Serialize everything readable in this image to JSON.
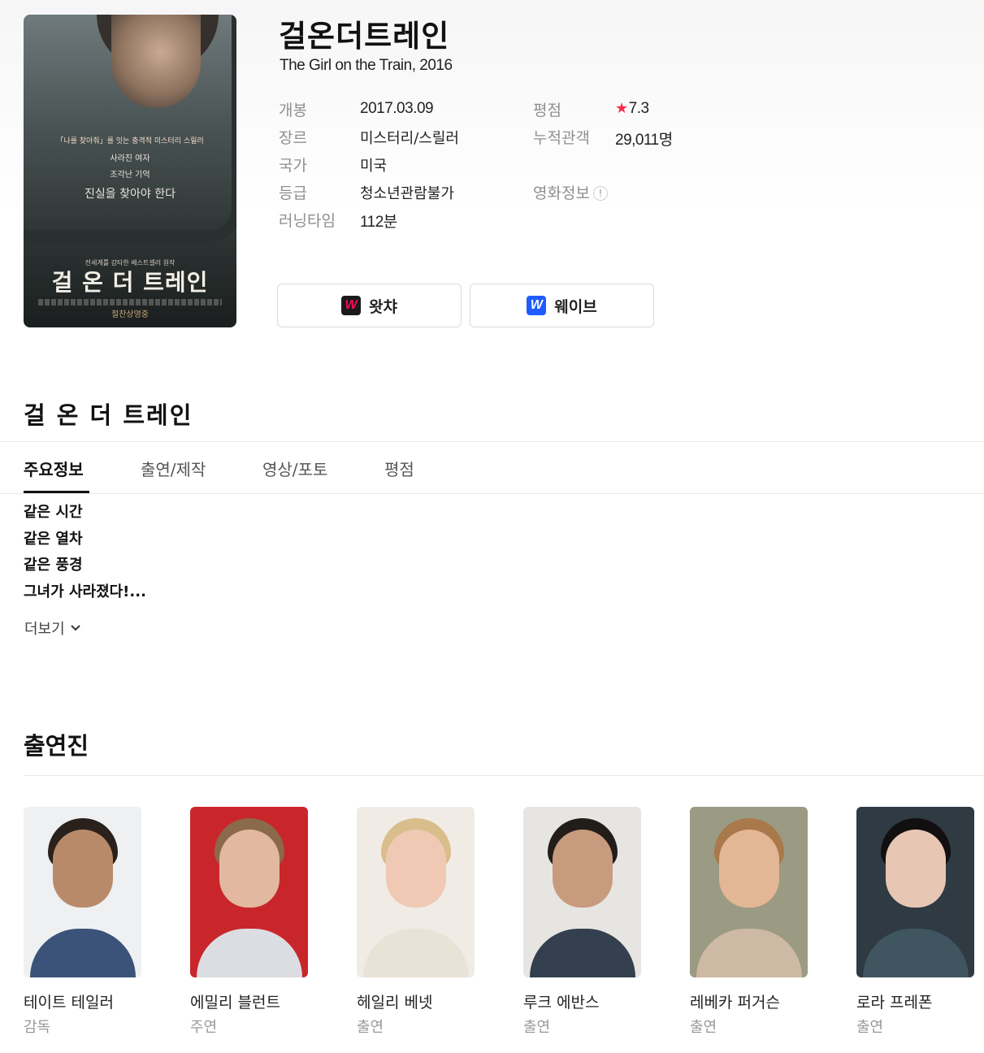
{
  "poster": {
    "tagline_1": "「나를 찾아줘」를 잇는 충격적 미스터리 스릴러",
    "tagline_2": "사라진 여자",
    "tagline_3": "조각난 기억",
    "tagline_4": "진실을 찾아야 한다",
    "top_text": "전세계를 강타한 베스트셀러 원작",
    "poster_title": "걸 온 더 트레인",
    "bottom_text": "절찬상영중"
  },
  "movie": {
    "title": "걸온더트레인",
    "subtitle": "The Girl on the Train, 2016"
  },
  "info": {
    "release_label": "개봉",
    "release_value": "2017.03.09",
    "genre_label": "장르",
    "genre_value": "미스터리/스릴러",
    "country_label": "국가",
    "country_value": "미국",
    "rating_label": "등급",
    "rating_value": "청소년관람불가",
    "runtime_label": "러닝타임",
    "runtime_value": "112분",
    "score_label": "평점",
    "score_value": "7.3",
    "audience_label": "누적관객",
    "audience_value": "29,011명",
    "movie_info_label": "영화정보"
  },
  "ott": [
    {
      "label": "왓챠",
      "logo": "W",
      "icon": "watcha-logo-icon",
      "color": "#ff0558"
    },
    {
      "label": "웨이브",
      "logo": "W",
      "icon": "wavve-logo-icon",
      "color": "#1f5bff"
    }
  ],
  "section_title": "걸 온 더 트레인",
  "tabs": [
    {
      "label": "주요정보",
      "active": true
    },
    {
      "label": "출연/제작",
      "active": false
    },
    {
      "label": "영상/포토",
      "active": false
    },
    {
      "label": "평점",
      "active": false
    }
  ],
  "synopsis": {
    "lines": [
      "같은 시간",
      "같은 열차",
      "같은 풍경",
      "그녀가 사라졌다!..."
    ],
    "more_label": "더보기"
  },
  "cast_title": "출연진",
  "cast": [
    {
      "name": "테이트 테일러",
      "role": "감독"
    },
    {
      "name": "에밀리 블런트",
      "role": "주연"
    },
    {
      "name": "헤일리 베넷",
      "role": "출연"
    },
    {
      "name": "루크 에반스",
      "role": "출연"
    },
    {
      "name": "레베카 퍼거슨",
      "role": "출연"
    },
    {
      "name": "로라 프레폰",
      "role": "출연"
    }
  ],
  "colors": {
    "accent_star": "#ff2b4a",
    "watcha": "#ff0558",
    "wavve": "#1f5bff"
  }
}
